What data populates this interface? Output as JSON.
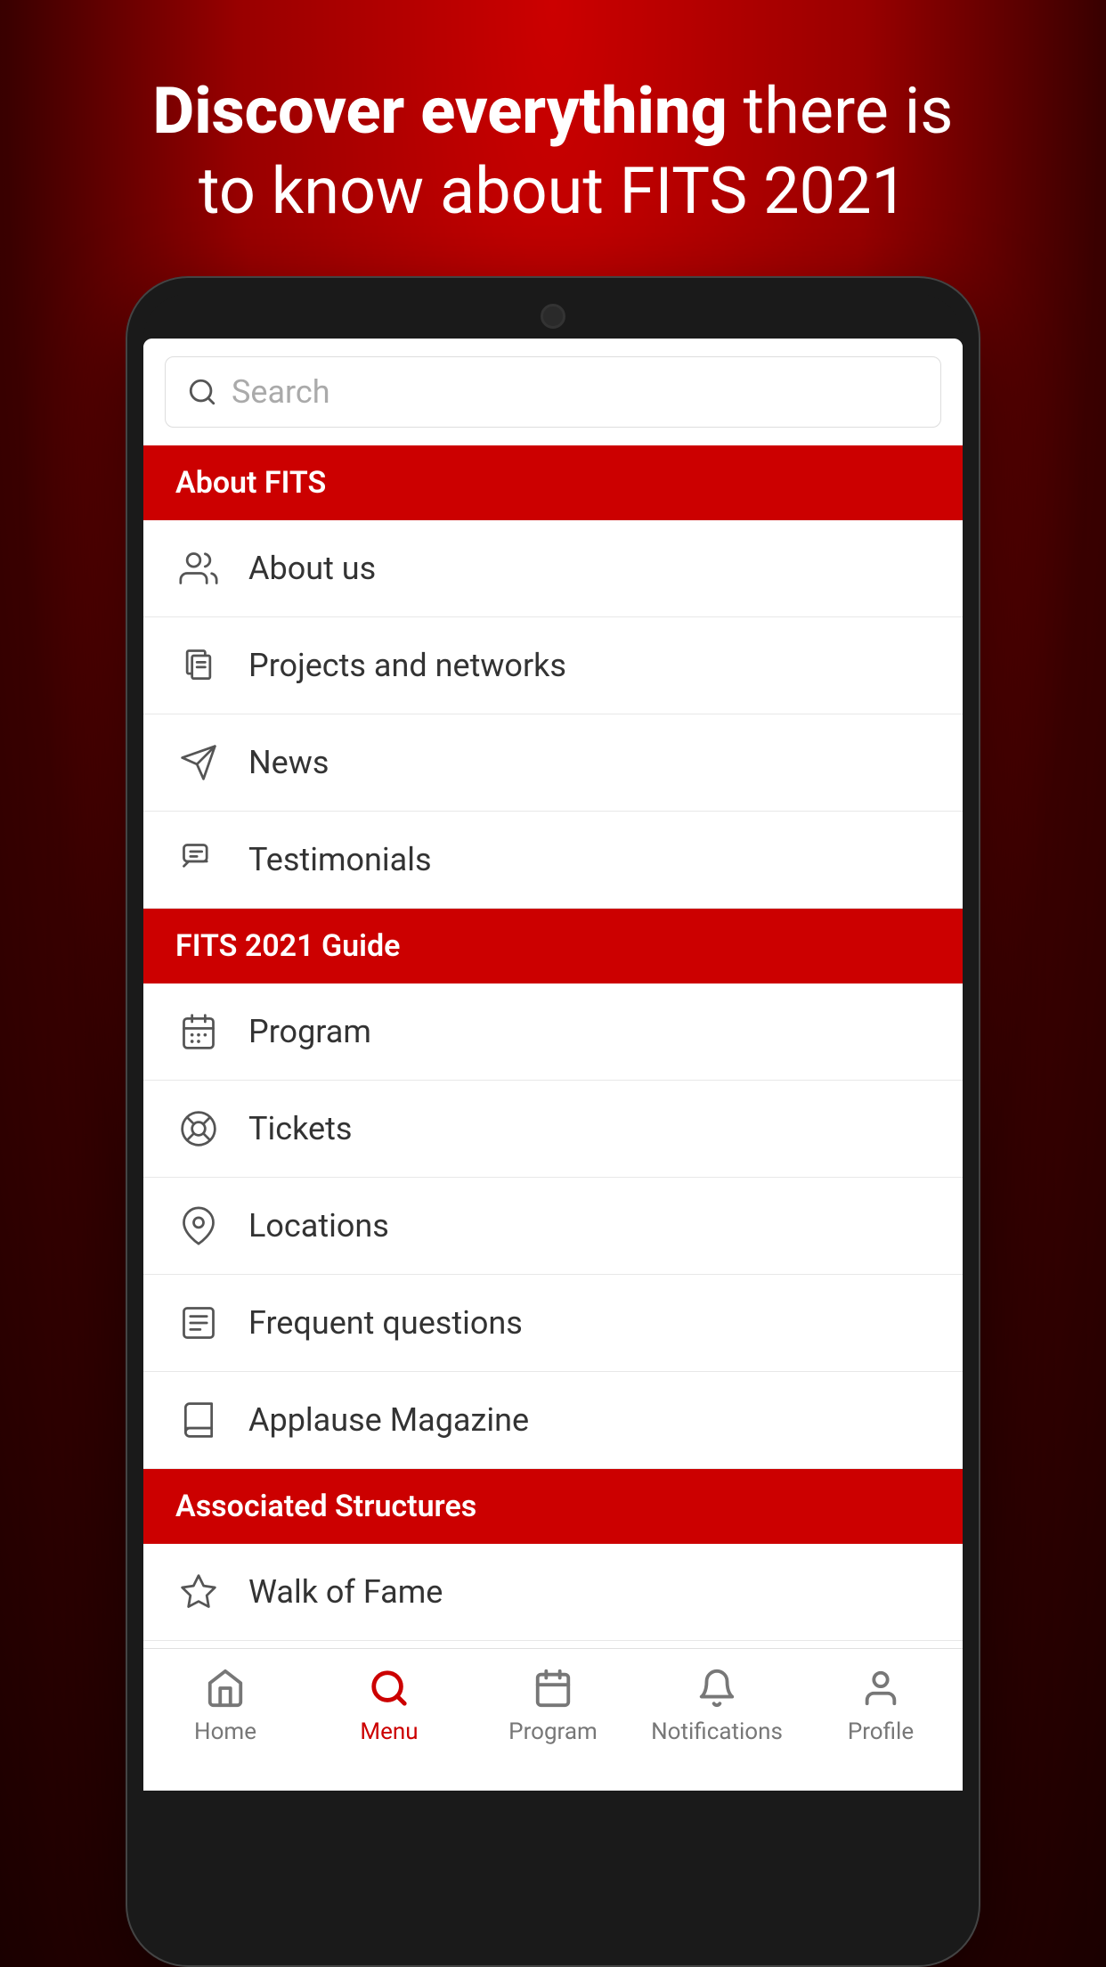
{
  "hero": {
    "line1_bold": "Discover everything",
    "line1_rest": " there is",
    "line2": "to know about FITS 2021"
  },
  "search": {
    "placeholder": "Search"
  },
  "sections": [
    {
      "id": "about-fits",
      "label": "About FITS",
      "items": [
        {
          "id": "about-us",
          "label": "About us",
          "icon": "people-icon"
        },
        {
          "id": "projects-networks",
          "label": "Projects and networks",
          "icon": "documents-icon"
        },
        {
          "id": "news",
          "label": "News",
          "icon": "send-icon"
        },
        {
          "id": "testimonials",
          "label": "Testimonials",
          "icon": "chat-icon"
        }
      ]
    },
    {
      "id": "fits-guide",
      "label": "FITS 2021 Guide",
      "items": [
        {
          "id": "program",
          "label": "Program",
          "icon": "calendar-icon"
        },
        {
          "id": "tickets",
          "label": "Tickets",
          "icon": "ticket-icon"
        },
        {
          "id": "locations",
          "label": "Locations",
          "icon": "location-icon"
        },
        {
          "id": "frequent-questions",
          "label": "Frequent questions",
          "icon": "faq-icon"
        },
        {
          "id": "applause-magazine",
          "label": "Applause Magazine",
          "icon": "book-icon"
        }
      ]
    },
    {
      "id": "associated-structures",
      "label": "Associated Structures",
      "items": [
        {
          "id": "walk-of-fame",
          "label": "Walk of Fame",
          "icon": "star-icon"
        }
      ]
    }
  ],
  "bottomNav": [
    {
      "id": "home",
      "label": "Home",
      "icon": "home-icon",
      "active": false
    },
    {
      "id": "menu",
      "label": "Menu",
      "icon": "menu-icon",
      "active": true
    },
    {
      "id": "program-nav",
      "label": "Program",
      "icon": "calendar-nav-icon",
      "active": false
    },
    {
      "id": "notifications",
      "label": "Notifications",
      "icon": "bell-icon",
      "active": false
    },
    {
      "id": "profile",
      "label": "Profile",
      "icon": "person-icon",
      "active": false
    }
  ]
}
